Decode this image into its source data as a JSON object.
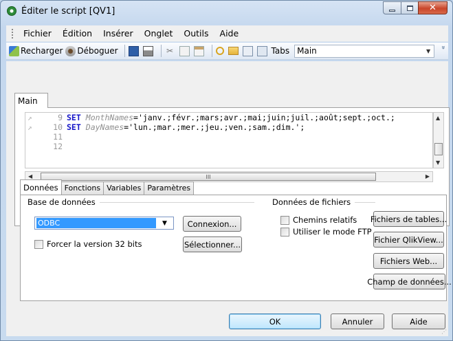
{
  "window": {
    "title": "Éditer le script [QV1]"
  },
  "menu": [
    "Fichier",
    "Édition",
    "Insérer",
    "Onglet",
    "Outils",
    "Aide"
  ],
  "toolbar": {
    "reload_label": "Recharger",
    "debug_label": "Déboguer",
    "tabs_label": "Tabs",
    "tab_selected": "Main"
  },
  "editor": {
    "tab_label": "Main",
    "lines": [
      {
        "num": "9",
        "keyword": "SET",
        "variable": "MonthNames",
        "value": "='janv.;févr.;mars;avr.;mai;juin;juil.;août;sept.;oct.;"
      },
      {
        "num": "10",
        "keyword": "SET",
        "variable": "DayNames",
        "value": "='lun.;mar.;mer.;jeu.;ven.;sam.;dim.';"
      },
      {
        "num": "11",
        "keyword": "",
        "variable": "",
        "value": ""
      },
      {
        "num": "12",
        "keyword": "",
        "variable": "",
        "value": ""
      }
    ],
    "hscroll_grip": "III"
  },
  "bottom_tabs": [
    "Données",
    "Fonctions",
    "Variables",
    "Paramètres"
  ],
  "data_tab": {
    "db_group_label": "Base de données",
    "db_selected": "ODBC",
    "connect_button": "Connexion...",
    "select_button": "Sélectionner...",
    "force32_label": "Forcer la version 32 bits",
    "file_group_label": "Données de fichiers",
    "relative_paths_label": "Chemins relatifs",
    "ftp_mode_label": "Utiliser le mode FTP",
    "table_files_button": "Fichiers de tables...",
    "qlikview_file_button": "Fichier QlikView...",
    "web_files_button": "Fichiers Web...",
    "data_field_button": "Champ de données..."
  },
  "footer": {
    "ok": "OK",
    "cancel": "Annuler",
    "help": "Aide"
  }
}
